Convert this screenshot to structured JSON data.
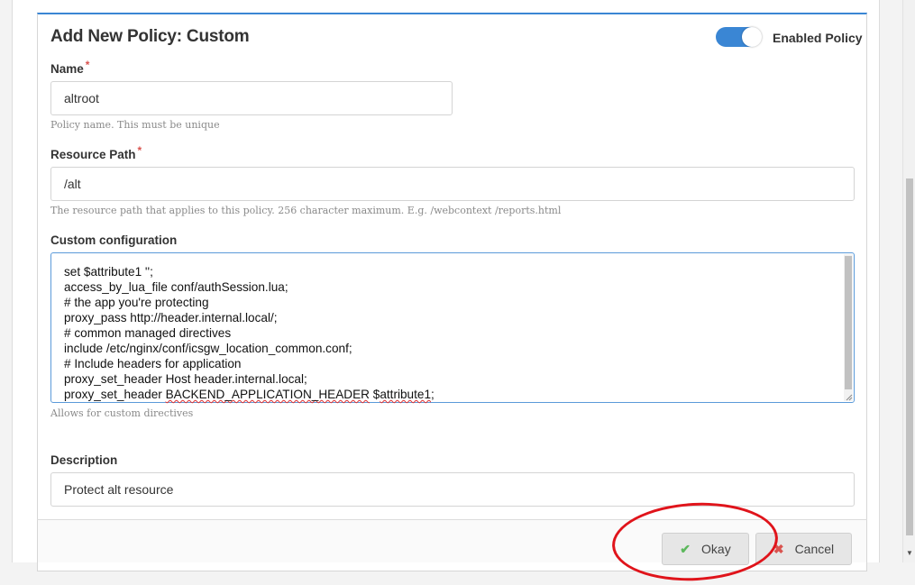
{
  "dialog": {
    "title": "Add New Policy: Custom",
    "enabled_label": "Enabled Policy",
    "enabled": true
  },
  "fields": {
    "name": {
      "label": "Name",
      "required_mark": "*",
      "value": "altroot",
      "help": "Policy name. This must be unique"
    },
    "resource_path": {
      "label": "Resource Path",
      "required_mark": "*",
      "value": "/alt",
      "help": "The resource path that applies to this policy. 256 character maximum. E.g. /webcontext /reports.html"
    },
    "custom_configuration": {
      "label": "Custom configuration",
      "lines": [
        "set $attribute1 '';",
        "access_by_lua_file conf/authSession.lua;",
        "# the app you're protecting",
        "proxy_pass http://header.internal.local/;",
        "# common managed directives",
        "include /etc/nginx/conf/icsgw_location_common.conf;",
        "# Include headers for application",
        "proxy_set_header Host header.internal.local;"
      ],
      "last_line_prefix": "proxy_set_header ",
      "last_line_misspelled_1": "BACKEND_APPLICATION_HEADER",
      "last_line_middle": " $",
      "last_line_misspelled_2": "attribute1",
      "last_line_suffix": ";",
      "help": "Allows for custom directives"
    },
    "description": {
      "label": "Description",
      "value": "Protect alt resource"
    }
  },
  "buttons": {
    "okay_label": "Okay",
    "okay_icon": "check-icon",
    "cancel_label": "Cancel",
    "cancel_icon": "x-icon"
  },
  "colors": {
    "accent": "#3a86d4",
    "required": "#d9534f",
    "annotation": "#e0141b"
  }
}
